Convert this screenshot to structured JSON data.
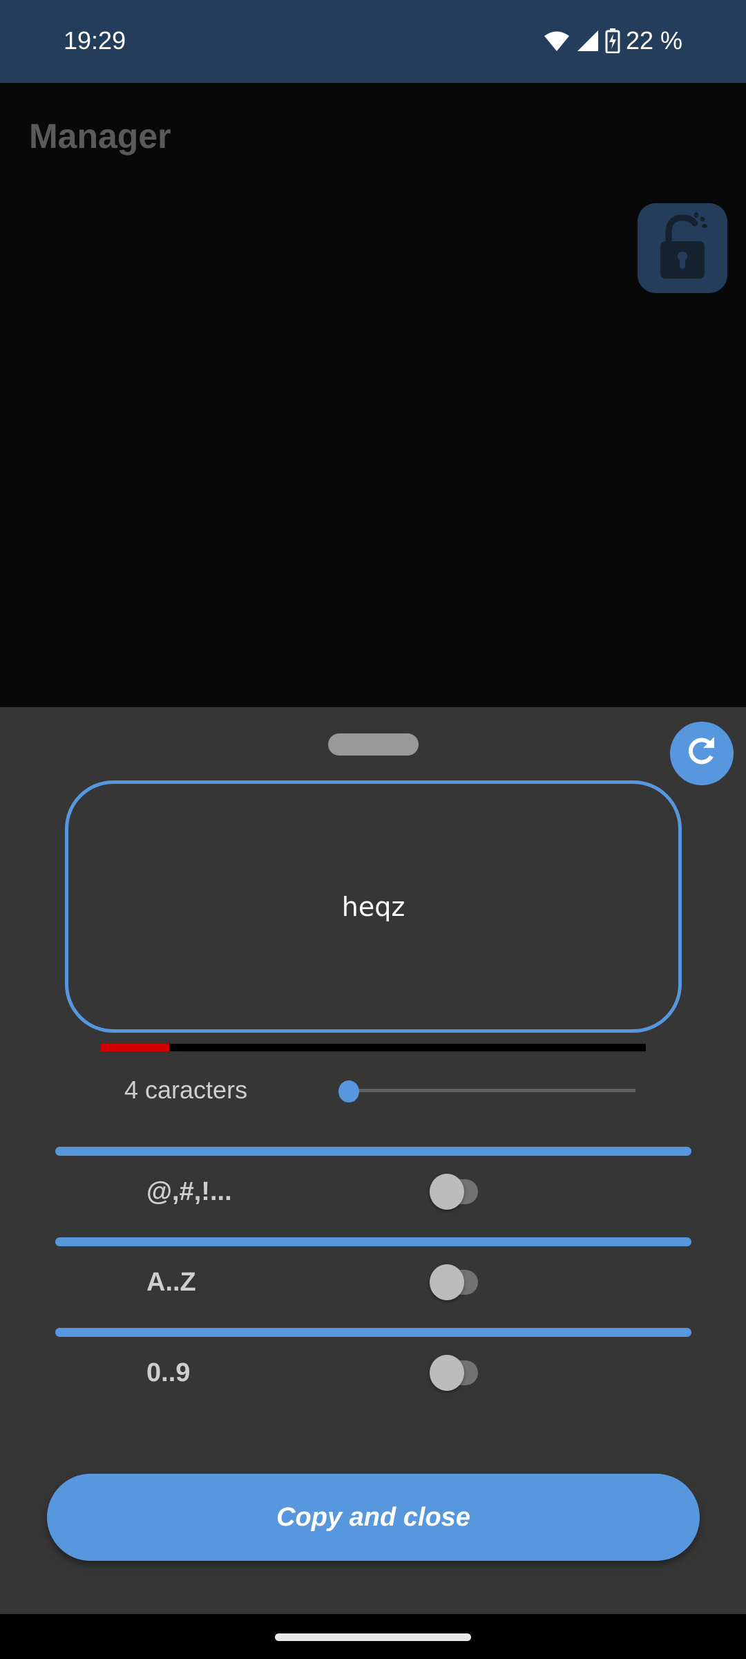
{
  "status_bar": {
    "time": "19:29",
    "battery_percent": "22 %",
    "icons": [
      "wifi-icon",
      "cellular-signal-icon",
      "battery-charging-icon"
    ]
  },
  "app": {
    "title": "Manager",
    "lock_button_icon": "unlocked-padlock-icon"
  },
  "sheet": {
    "refresh_icon": "refresh-icon",
    "password": "heqz",
    "strength_fraction": 0.125,
    "strength_color": "#d10000",
    "length": {
      "label": "4 caracters",
      "value": 4,
      "slider_fraction": 0.0
    },
    "options": [
      {
        "label": "@,#,!...",
        "enabled": false
      },
      {
        "label": "A..Z",
        "enabled": false
      },
      {
        "label": "0..9",
        "enabled": false
      }
    ],
    "copy_button_label": "Copy and close"
  },
  "colors": {
    "accent": "#5797dd",
    "status_bar_bg": "#243d5a",
    "sheet_bg": "#363636"
  }
}
